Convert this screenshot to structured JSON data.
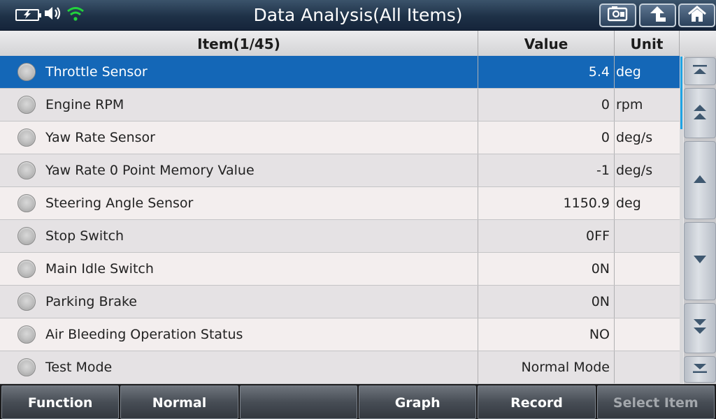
{
  "header": {
    "title": "Data Analysis(All Items)"
  },
  "columns": {
    "item": "Item(1/45)",
    "value": "Value",
    "unit": "Unit"
  },
  "rows": [
    {
      "name": "Throttle Sensor",
      "value": "5.4",
      "unit": "deg",
      "selected": true
    },
    {
      "name": "Engine RPM",
      "value": "0",
      "unit": "rpm"
    },
    {
      "name": "Yaw Rate Sensor",
      "value": "0",
      "unit": "deg/s"
    },
    {
      "name": "Yaw Rate 0 Point Memory Value",
      "value": "-1",
      "unit": "deg/s"
    },
    {
      "name": "Steering Angle Sensor",
      "value": "1150.9",
      "unit": "deg"
    },
    {
      "name": "Stop Switch",
      "value": "0FF",
      "unit": ""
    },
    {
      "name": "Main Idle Switch",
      "value": "0N",
      "unit": ""
    },
    {
      "name": "Parking Brake",
      "value": "0N",
      "unit": ""
    },
    {
      "name": "Air Bleeding Operation Status",
      "value": "NO",
      "unit": ""
    },
    {
      "name": "Test Mode",
      "value": "Normal Mode",
      "unit": ""
    }
  ],
  "footer": {
    "buttons": [
      {
        "label": "Function",
        "enabled": true
      },
      {
        "label": "Normal",
        "enabled": true
      },
      {
        "label": "",
        "enabled": true
      },
      {
        "label": "Graph",
        "enabled": true
      },
      {
        "label": "Record",
        "enabled": true
      },
      {
        "label": "Select Item",
        "enabled": false
      }
    ]
  },
  "icons": {
    "battery": "battery-charging-icon",
    "volume": "speaker-icon",
    "wifi": "wifi-icon",
    "screenshot": "screenshot-icon",
    "back": "back-arrow-icon",
    "home": "home-icon"
  },
  "colors": {
    "selection": "#1467b7",
    "wifi": "#22d33c",
    "scroll_thumb": "#1ea3e3"
  }
}
